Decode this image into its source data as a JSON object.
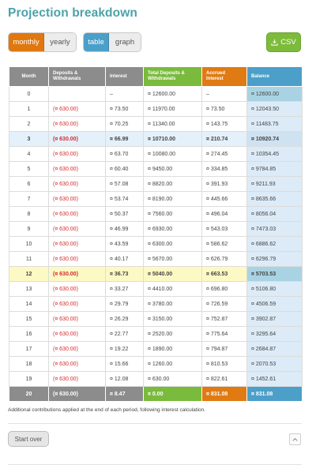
{
  "title": "Projection breakdown",
  "mode_toggle": {
    "active": "monthly",
    "inactive": "yearly"
  },
  "view_toggle": {
    "active": "table",
    "inactive": "graph"
  },
  "csv_label": "CSV",
  "table": {
    "headers": [
      "Month",
      "Deposits & Withdrawals",
      "Interest",
      "Total Deposits & Withdrawals",
      "Accrued Interest",
      "Balance"
    ],
    "rows": [
      [
        "0",
        "",
        "¤ 12600.00",
        "–",
        "¤ 12600.00",
        "–",
        "¤ 12600.00"
      ],
      [
        "1",
        "(¤ 630.00)",
        "¤ 73.50",
        "¤ 11970.00",
        "¤ 73.50",
        "¤ 12043.50"
      ],
      [
        "2",
        "(¤ 630.00)",
        "¤ 70.25",
        "¤ 11340.00",
        "¤ 143.75",
        "¤ 11483.75"
      ],
      [
        "3",
        "(¤ 630.00)",
        "¤ 66.99",
        "¤ 10710.00",
        "¤ 210.74",
        "¤ 10920.74"
      ],
      [
        "4",
        "(¤ 630.00)",
        "¤ 63.70",
        "¤ 10080.00",
        "¤ 274.45",
        "¤ 10354.45"
      ],
      [
        "5",
        "(¤ 630.00)",
        "¤ 60.40",
        "¤ 9450.00",
        "¤ 334.85",
        "¤ 9784.85"
      ],
      [
        "6",
        "(¤ 630.00)",
        "¤ 57.08",
        "¤ 8820.00",
        "¤ 391.93",
        "¤ 9211.93"
      ],
      [
        "7",
        "(¤ 630.00)",
        "¤ 53.74",
        "¤ 8190.00",
        "¤ 445.66",
        "¤ 8635.66"
      ],
      [
        "8",
        "(¤ 630.00)",
        "¤ 50.37",
        "¤ 7560.00",
        "¤ 496.04",
        "¤ 8056.04"
      ],
      [
        "9",
        "(¤ 630.00)",
        "¤ 46.99",
        "¤ 6930.00",
        "¤ 543.03",
        "¤ 7473.03"
      ],
      [
        "10",
        "(¤ 630.00)",
        "¤ 43.59",
        "¤ 6300.00",
        "¤ 586.62",
        "¤ 6886.62"
      ],
      [
        "11",
        "(¤ 630.00)",
        "¤ 40.17",
        "¤ 5670.00",
        "¤ 626.79",
        "¤ 6296.79"
      ],
      [
        "12",
        "(¤ 630.00)",
        "¤ 36.73",
        "¤ 5040.00",
        "¤ 663.53",
        "¤ 5703.53"
      ],
      [
        "13",
        "(¤ 630.00)",
        "¤ 33.27",
        "¤ 4410.00",
        "¤ 696.80",
        "¤ 5106.80"
      ],
      [
        "14",
        "(¤ 630.00)",
        "¤ 29.79",
        "¤ 3780.00",
        "¤ 726.59",
        "¤ 4506.59"
      ],
      [
        "15",
        "(¤ 630.00)",
        "¤ 26.29",
        "¤ 3150.00",
        "¤ 752.87",
        "¤ 3902.87"
      ],
      [
        "16",
        "(¤ 630.00)",
        "¤ 22.77",
        "¤ 2520.00",
        "¤ 775.64",
        "¤ 3295.64"
      ],
      [
        "17",
        "(¤ 630.00)",
        "¤ 19.22",
        "¤ 1890.00",
        "¤ 794.87",
        "¤ 2684.87"
      ],
      [
        "18",
        "(¤ 630.00)",
        "¤ 15.66",
        "¤ 1260.00",
        "¤ 810.53",
        "¤ 2070.53"
      ],
      [
        "19",
        "(¤ 630.00)",
        "¤ 12.08",
        "¤ 630.00",
        "¤ 822.61",
        "¤ 1452.61"
      ]
    ],
    "footer": [
      "20",
      "(¤ 630.00)",
      "¤ 8.47",
      "¤ 0.00",
      "¤ 831.08",
      "¤ 831.08"
    ]
  },
  "note": "Additional contributions applied at the end of each period, following interest calculation.",
  "start_over_label": "Start over",
  "colors": {
    "title": "#4aa3a8",
    "monthly": "#e0780f",
    "table": "#4b9fc9",
    "csv": "#7dbb3a",
    "negative": "#d6282b"
  }
}
